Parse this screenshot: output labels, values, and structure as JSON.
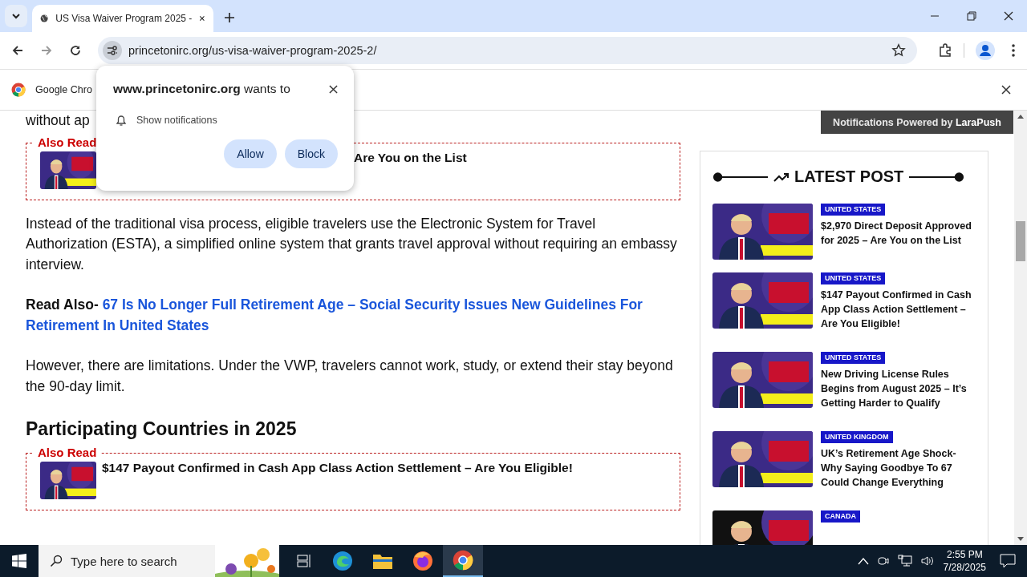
{
  "browser": {
    "tab": {
      "title": "US Visa Waiver Program 2025 -",
      "selected": true
    },
    "url": "princetonirc.org/us-visa-waiver-program-2025-2/",
    "infobar": {
      "text": "Google Chro"
    }
  },
  "permission_popup": {
    "title": "**www.princetonirc.org** wants to",
    "permission": "Show notifications",
    "buttons": [
      "Allow",
      "Block"
    ]
  },
  "larapush_bar": {
    "text": "Notifications Powered by **LaraPush**"
  },
  "article": {
    "blocks": [
      {
        "kind": "text",
        "text": "without ap"
      },
      {
        "kind": "also_read",
        "label": "Also Read",
        "title": "Are You on the List"
      },
      {
        "kind": "text",
        "text": "Instead of the traditional visa process, eligible travelers use the Electronic System for Travel Authorization (ESTA), a simplified online system that grants travel approval without requiring an embassy interview."
      },
      {
        "kind": "link",
        "label": "Read Also-",
        "link": "67 Is No Longer Full Retirement Age – Social Security Issues New Guidelines For Retirement In United States"
      },
      {
        "kind": "text",
        "text": "However, there are limitations. Under the VWP, travelers cannot work, study, or extend their stay beyond the 90-day limit."
      },
      {
        "kind": "heading",
        "text": "Participating Countries in 2025"
      },
      {
        "kind": "also_read",
        "label": "Also Read",
        "title": "$147 Payout Confirmed in Cash App Class Action Settlement – Are You Eligible!"
      }
    ]
  },
  "sidebar": {
    "title": "LATEST POST",
    "posts": [
      {
        "category": "UNITED STATES",
        "title": "$2,970 Direct Deposit Approved for 2025 – Are You on the List"
      },
      {
        "category": "UNITED STATES",
        "title": "$147 Payout Confirmed in Cash App Class Action Settlement – Are You Eligible!"
      },
      {
        "category": "UNITED STATES",
        "title": "New Driving License Rules Begins from August 2025 – It’s Getting Harder to Qualify"
      },
      {
        "category": "UNITED KINGDOM",
        "title": "UK’s Retirement Age Shock- Why Saying Goodbye To 67 Could Change Everything"
      },
      {
        "category": "CANADA"
      }
    ]
  },
  "taskbar": {
    "search": {
      "placeholder": "Type here to search"
    },
    "time": "2:55 PM",
    "date": "7/28/2025"
  }
}
